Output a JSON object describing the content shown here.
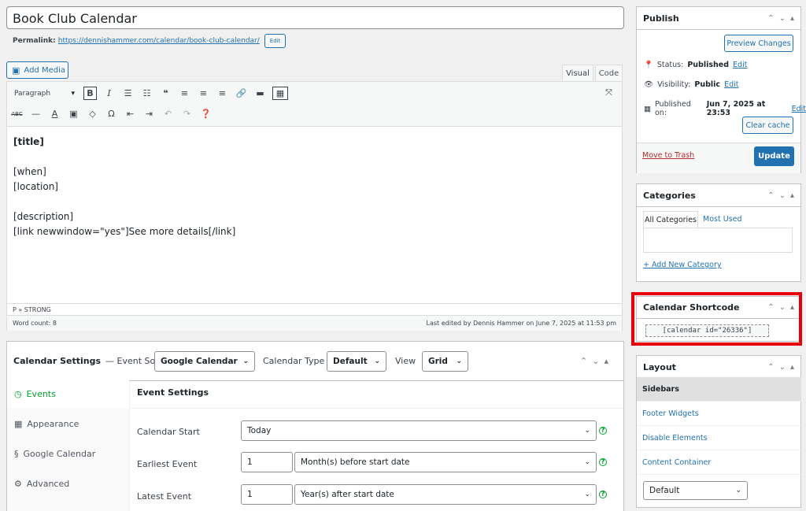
{
  "post": {
    "title": "Book Club Calendar",
    "permalink_label": "Permalink:",
    "permalink_url": "https://dennishammer.com/calendar/book-club-calendar/",
    "edit_label": "Edit"
  },
  "editor": {
    "add_media": "Add Media",
    "tab_visual": "Visual",
    "tab_code": "Code",
    "format_select": "Paragraph",
    "lines": [
      "[title]",
      "",
      "[when]",
      "[location]",
      "",
      "[description]",
      "[link newwindow=\"yes\"]See more details[/link]"
    ],
    "path": "P » STRONG",
    "word_count": "Word count: 8",
    "last_edited": "Last edited by Dennis Hammer on June 7, 2025 at 11:53 pm"
  },
  "publish": {
    "heading": "Publish",
    "preview": "Preview Changes",
    "status_label": "Status:",
    "status_value": "Published",
    "visibility_label": "Visibility:",
    "visibility_value": "Public",
    "published_label": "Published on:",
    "published_value": "Jun 7, 2025 at 23:53",
    "edit": "Edit",
    "clear_cache": "Clear cache",
    "trash": "Move to Trash",
    "update": "Update"
  },
  "categories": {
    "heading": "Categories",
    "tab_all": "All Categories",
    "tab_used": "Most Used",
    "add_new": "+ Add New Category"
  },
  "shortcode": {
    "heading": "Calendar Shortcode",
    "code": "[calendar id=\"26336\"]"
  },
  "layout": {
    "heading": "Layout",
    "items": [
      "Sidebars",
      "Footer Widgets",
      "Disable Elements",
      "Content Container"
    ],
    "select_value": "Default"
  },
  "calendar_settings": {
    "heading": "Calendar Settings",
    "event_source_label": "— Event Source",
    "event_source_value": "Google Calendar",
    "type_label": "Calendar Type",
    "type_value": "Default",
    "view_label": "View",
    "view_value": "Grid",
    "tabs": [
      "Events",
      "Appearance",
      "Google Calendar",
      "Advanced"
    ],
    "section_title": "Event Settings",
    "start_label": "Calendar Start",
    "start_value": "Today",
    "earliest_label": "Earliest Event",
    "earliest_num": "1",
    "earliest_unit": "Month(s) before start date",
    "latest_label": "Latest Event",
    "latest_num": "1",
    "latest_unit": "Year(s) after start date"
  },
  "colors": {
    "accent": "#2271b1",
    "highlight": "#e8000b",
    "success": "#00a32a"
  }
}
